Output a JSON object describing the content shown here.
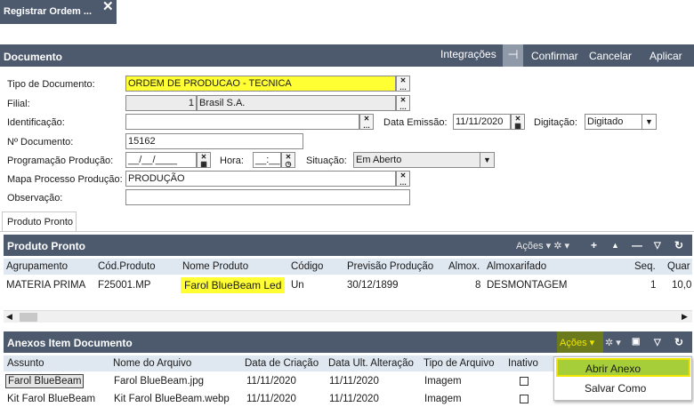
{
  "window_tab": {
    "title": "Registrar Ordem ...",
    "close": "✕"
  },
  "header": {
    "title": "Documento",
    "actions": [
      "Integrações",
      "Confirmar",
      "Cancelar",
      "Aplicar"
    ],
    "pin_icon": "pin-icon"
  },
  "form": {
    "tipo_documento": {
      "label": "Tipo de Documento:",
      "value": "ORDEM DE PRODUCAO - TECNICA"
    },
    "filial": {
      "label": "Filial:",
      "code": "1",
      "name": "Brasil S.A."
    },
    "identificacao": {
      "label": "Identificação:",
      "value": ""
    },
    "data_emissao": {
      "label": "Data Emissão:",
      "value": "11/11/2020"
    },
    "digitacao": {
      "label": "Digitação:",
      "value": "Digitado"
    },
    "n_documento": {
      "label": "Nº Documento:",
      "value": "15162"
    },
    "programacao": {
      "label": "Programação Produção:",
      "value": "__/__/____"
    },
    "hora": {
      "label": "Hora:",
      "value": "__:__"
    },
    "situacao": {
      "label": "Situação:",
      "value": "Em Aberto"
    },
    "mapa": {
      "label": "Mapa Processo Produção:",
      "value": "PRODUÇÃO"
    },
    "observacao": {
      "label": "Observação:",
      "value": ""
    }
  },
  "tabs": [
    "Produto Pronto"
  ],
  "produto_pronto": {
    "title": "Produto Pronto",
    "acoes": "Ações",
    "columns": [
      "Agrupamento",
      "Cód.Produto",
      "Nome Produto",
      "Código",
      "Previsão Produção",
      "Almox.",
      "Almoxarifado",
      "Seq.",
      "Quar"
    ],
    "rows": [
      [
        "MATERIA PRIMA",
        "F25001.MP",
        "Farol BlueBeam Led",
        "Un",
        "30/12/1899",
        "8",
        "DESMONTAGEM",
        "1",
        "10,0"
      ]
    ]
  },
  "anexos": {
    "title": "Anexos Item Documento",
    "acoes": "Ações",
    "columns": [
      "Assunto",
      "Nome do Arquivo",
      "Data de Criação",
      "Data Ult. Alteração",
      "Tipo de Arquivo",
      "Inativo"
    ],
    "rows": [
      [
        "Farol BlueBeam",
        "Farol BlueBeam.jpg",
        "11/11/2020",
        "11/11/2020",
        "Imagem"
      ],
      [
        "Kit Farol BlueBeam",
        "Kit Farol BlueBeam.webp",
        "11/11/2020",
        "11/11/2020",
        "Imagem"
      ]
    ]
  },
  "context_menu": {
    "items": [
      "Abrir Anexo",
      "Salvar Como"
    ]
  },
  "colors": {
    "header_bar": "#4d5a6e",
    "highlight_yellow": "#ffff33",
    "menu_highlight": "#a6ce39",
    "grid_header": "#dfe7f0"
  }
}
